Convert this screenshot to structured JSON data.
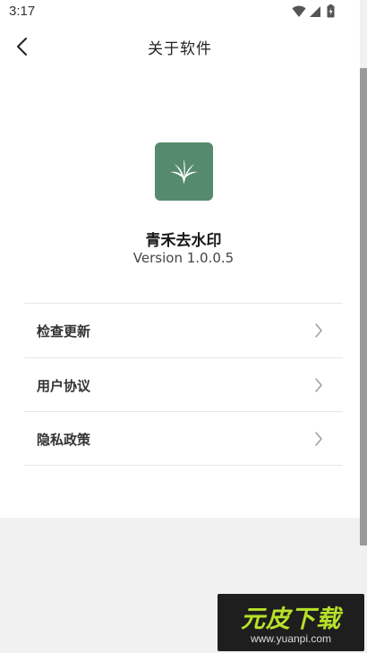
{
  "status_bar": {
    "time": "3:17",
    "icons": [
      "wifi-icon",
      "cellular-signal-icon",
      "battery-charging-icon"
    ]
  },
  "header": {
    "title": "关于软件",
    "back_icon": "chevron-left-icon"
  },
  "app": {
    "name": "青禾去水印",
    "version": "Version 1.0.0.5",
    "logo_icon": "sprout-leaves-icon",
    "logo_color": "#568a6e"
  },
  "menu": {
    "items": [
      {
        "label": "检查更新",
        "icon": "chevron-right-icon"
      },
      {
        "label": "用户协议",
        "icon": "chevron-right-icon"
      },
      {
        "label": "隐私政策",
        "icon": "chevron-right-icon"
      }
    ]
  },
  "watermark": {
    "brand": "元皮下载",
    "url": "www.yuanpi.com",
    "brand_color": "#b7e12a"
  }
}
